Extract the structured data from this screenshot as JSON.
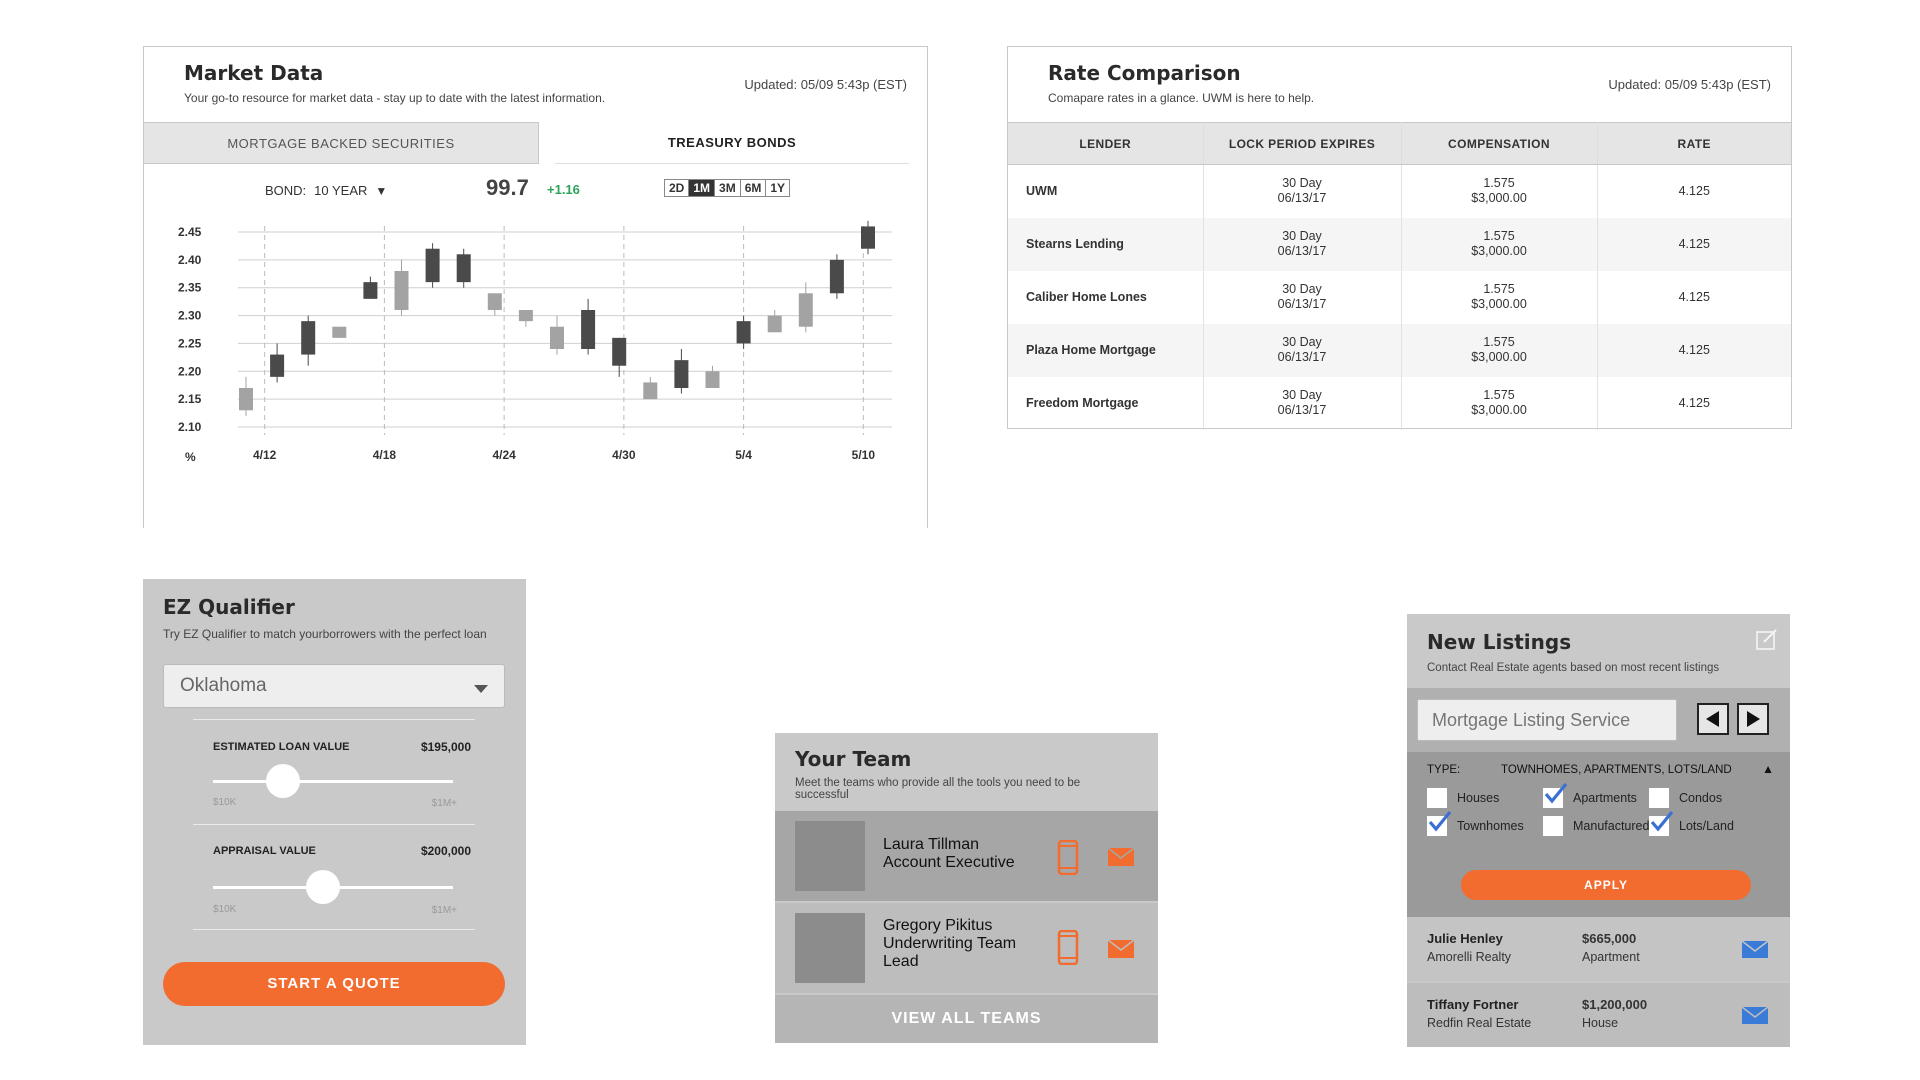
{
  "market": {
    "title": "Market Data",
    "subtitle": "Your go-to resource for market data - stay up to date with the latest information.",
    "updated": "Updated: 05/09 5:43p (EST)",
    "tabs": [
      "MORTGAGE BACKED SECURITIES",
      "TREASURY BONDS"
    ],
    "active_tab": "TREASURY BONDS",
    "bond_label": "BOND:",
    "bond_value": "10 YEAR",
    "bond_caret": "▼",
    "price": "99.7",
    "change": "+1.16",
    "ranges": [
      "2D",
      "1M",
      "3M",
      "6M",
      "1Y"
    ],
    "active_range": "1M",
    "colors": {
      "dark_candle": "#4a4a4a",
      "light_candle": "#a3a3a3",
      "change_up": "#2ea35a"
    }
  },
  "chart_data": {
    "type": "candlestick",
    "y_unit_label": "%",
    "ylim": [
      2.1,
      2.45
    ],
    "y_ticks": [
      "2.45",
      "2.40",
      "2.35",
      "2.30",
      "2.25",
      "2.20",
      "2.15",
      "2.10"
    ],
    "x_ticks": [
      "4/12",
      "4/18",
      "4/24",
      "4/30",
      "5/4",
      "5/10"
    ],
    "grid": true,
    "candles": [
      {
        "open": 2.13,
        "close": 2.17,
        "high": 2.19,
        "low": 2.12,
        "tone": "light"
      },
      {
        "open": 2.19,
        "close": 2.23,
        "high": 2.25,
        "low": 2.18,
        "tone": "dark"
      },
      {
        "open": 2.23,
        "close": 2.29,
        "high": 2.3,
        "low": 2.21,
        "tone": "dark"
      },
      {
        "open": 2.26,
        "close": 2.28,
        "high": 2.28,
        "low": 2.26,
        "tone": "light"
      },
      {
        "open": 2.33,
        "close": 2.36,
        "high": 2.37,
        "low": 2.33,
        "tone": "dark"
      },
      {
        "open": 2.31,
        "close": 2.38,
        "high": 2.4,
        "low": 2.3,
        "tone": "light"
      },
      {
        "open": 2.36,
        "close": 2.42,
        "high": 2.43,
        "low": 2.35,
        "tone": "dark"
      },
      {
        "open": 2.36,
        "close": 2.41,
        "high": 2.42,
        "low": 2.35,
        "tone": "dark"
      },
      {
        "open": 2.31,
        "close": 2.34,
        "high": 2.34,
        "low": 2.3,
        "tone": "light"
      },
      {
        "open": 2.29,
        "close": 2.31,
        "high": 2.31,
        "low": 2.28,
        "tone": "light"
      },
      {
        "open": 2.24,
        "close": 2.28,
        "high": 2.3,
        "low": 2.23,
        "tone": "light"
      },
      {
        "open": 2.24,
        "close": 2.31,
        "high": 2.33,
        "low": 2.23,
        "tone": "dark"
      },
      {
        "open": 2.21,
        "close": 2.26,
        "high": 2.26,
        "low": 2.19,
        "tone": "dark"
      },
      {
        "open": 2.15,
        "close": 2.18,
        "high": 2.19,
        "low": 2.15,
        "tone": "light"
      },
      {
        "open": 2.17,
        "close": 2.22,
        "high": 2.24,
        "low": 2.16,
        "tone": "dark"
      },
      {
        "open": 2.17,
        "close": 2.2,
        "high": 2.21,
        "low": 2.17,
        "tone": "light"
      },
      {
        "open": 2.25,
        "close": 2.29,
        "high": 2.3,
        "low": 2.24,
        "tone": "dark"
      },
      {
        "open": 2.27,
        "close": 2.3,
        "high": 2.31,
        "low": 2.27,
        "tone": "light"
      },
      {
        "open": 2.28,
        "close": 2.34,
        "high": 2.36,
        "low": 2.27,
        "tone": "light"
      },
      {
        "open": 2.34,
        "close": 2.4,
        "high": 2.41,
        "low": 2.33,
        "tone": "dark"
      },
      {
        "open": 2.42,
        "close": 2.46,
        "high": 2.47,
        "low": 2.41,
        "tone": "dark"
      }
    ]
  },
  "rates": {
    "title": "Rate Comparison",
    "subtitle": "Comapare rates in a glance. UWM is here to help.",
    "updated": "Updated: 05/09 5:43p (EST)",
    "columns": [
      "LENDER",
      "LOCK PERIOD EXPIRES",
      "COMPENSATION",
      "RATE"
    ],
    "rows": [
      {
        "lender": "UWM",
        "lock": "30 Day",
        "expires": "06/13/17",
        "comp_pct": "1.575",
        "comp_amt": "$3,000.00",
        "rate": "4.125"
      },
      {
        "lender": "Stearns Lending",
        "lock": "30 Day",
        "expires": "06/13/17",
        "comp_pct": "1.575",
        "comp_amt": "$3,000.00",
        "rate": "4.125"
      },
      {
        "lender": "Caliber Home Lones",
        "lock": "30 Day",
        "expires": "06/13/17",
        "comp_pct": "1.575",
        "comp_amt": "$3,000.00",
        "rate": "4.125"
      },
      {
        "lender": "Plaza Home Mortgage",
        "lock": "30 Day",
        "expires": "06/13/17",
        "comp_pct": "1.575",
        "comp_amt": "$3,000.00",
        "rate": "4.125"
      },
      {
        "lender": "Freedom Mortgage",
        "lock": "30 Day",
        "expires": "06/13/17",
        "comp_pct": "1.575",
        "comp_amt": "$3,000.00",
        "rate": "4.125"
      }
    ]
  },
  "ez": {
    "title": "EZ Qualifier",
    "subtitle": "Try EZ Qualifier to match yourborrowers with the perfect loan",
    "state": "Oklahoma",
    "sliders": [
      {
        "label": "ESTIMATED LOAN VALUE",
        "value": "$195,000",
        "min": "$10K",
        "max": "$1M+",
        "position": 0.29
      },
      {
        "label": "APPRAISAL VALUE",
        "value": "$200,000",
        "min": "$10K",
        "max": "$1M+",
        "position": 0.46
      }
    ],
    "button": "START A QUOTE"
  },
  "team": {
    "title": "Your Team",
    "subtitle": "Meet the teams who provide all the tools you need to be successful",
    "members": [
      {
        "name": "Laura Tillman",
        "role": "Account Executive"
      },
      {
        "name": "Gregory Pikitus",
        "role": "Underwriting Team Lead"
      }
    ],
    "view_all": "VIEW ALL TEAMS",
    "colors": {
      "accent": "#f26b2f"
    }
  },
  "listings": {
    "title": "New Listings",
    "subtitle": "Contact Real Estate agents based on most recent listings",
    "search_placeholder": "Mortgage Listing Service",
    "type_label": "TYPE:",
    "type_value": "TOWNHOMES, APARTMENTS, LOTS/LAND",
    "type_caret": "▲",
    "options": [
      {
        "label": "Houses",
        "checked": false
      },
      {
        "label": "Apartments",
        "checked": true
      },
      {
        "label": "Condos",
        "checked": false
      },
      {
        "label": "Townhomes",
        "checked": true
      },
      {
        "label": "Manufactured",
        "checked": false
      },
      {
        "label": "Lots/Land",
        "checked": true
      }
    ],
    "apply": "APPLY",
    "items": [
      {
        "name": "Julie Henley",
        "company": "Amorelli Realty",
        "price": "$665,000",
        "type": "Apartment"
      },
      {
        "name": "Tiffany Fortner",
        "company": "Redfin Real Estate",
        "price": "$1,200,000",
        "type": "House"
      }
    ],
    "colors": {
      "check": "#3b6fd1",
      "mail": "#3b7bd8",
      "apply": "#f26b2f"
    }
  }
}
